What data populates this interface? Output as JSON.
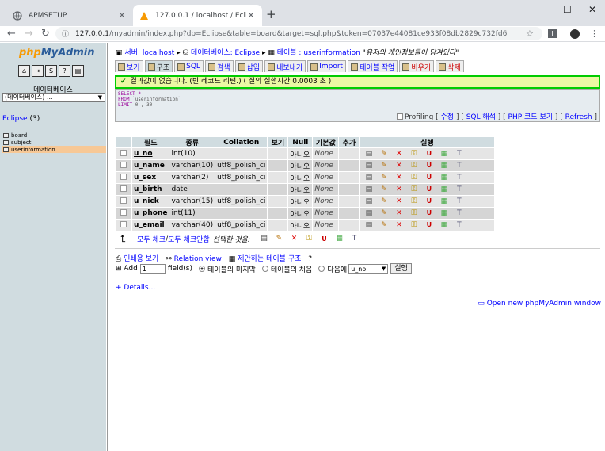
{
  "browser": {
    "tabs": [
      {
        "title": "APMSETUP",
        "active": false
      },
      {
        "title": "127.0.0.1 / localhost / Eclipse / ",
        "active": true
      }
    ],
    "url_host": "127.0.0.1",
    "url_path": "/myadmin/index.php?db=Eclipse&table=board&target=sql.php&token=07037e44081ce933f08db2829c732fd6"
  },
  "left": {
    "logo_a": "php",
    "logo_b": "MyAdmin",
    "db_label": "데이터베이스",
    "db_select": "(데이터베이스) ...",
    "db_name": "Eclipse",
    "db_count": "(3)",
    "tables": [
      "board",
      "subject",
      "userinformation"
    ]
  },
  "breadcrumb": {
    "server": "서버: localhost",
    "database": "데이터베이스: Eclipse",
    "table": "테이블 : userinformation",
    "comment": "\"유저의 개인정보들이 담겨있다\""
  },
  "tabs": [
    "보기",
    "구조",
    "SQL",
    "검색",
    "삽입",
    "내보내기",
    "Import",
    "테이블 작업",
    "비우기",
    "삭제"
  ],
  "notice": "결과값이 없습니다. (빈 레코드 리턴.) ( 질의 실행시간 0.0003 초 )",
  "sql": {
    "select": "SELECT",
    "star": "*",
    "from": "FROM",
    "table": "`userinformation`",
    "limit": "LIMIT",
    "limit_val": "0 , 30"
  },
  "profiling": {
    "label": "Profiling",
    "edit": "수정",
    "explain": "SQL 해석",
    "php": "PHP 코드 보기",
    "refresh": "Refresh"
  },
  "table_headers": [
    "필드",
    "종류",
    "Collation",
    "보기",
    "Null",
    "기본값",
    "추가",
    "실행"
  ],
  "rows": [
    {
      "field": "u_no",
      "type": "int(10)",
      "collation": "",
      "null": "아니오",
      "default": "None",
      "pk": true
    },
    {
      "field": "u_name",
      "type": "varchar(10)",
      "collation": "utf8_polish_ci",
      "null": "아니오",
      "default": "None",
      "pk": false
    },
    {
      "field": "u_sex",
      "type": "varchar(2)",
      "collation": "utf8_polish_ci",
      "null": "아니오",
      "default": "None",
      "pk": false
    },
    {
      "field": "u_birth",
      "type": "date",
      "collation": "",
      "null": "아니오",
      "default": "None",
      "pk": false
    },
    {
      "field": "u_nick",
      "type": "varchar(15)",
      "collation": "utf8_polish_ci",
      "null": "아니오",
      "default": "None",
      "pk": false
    },
    {
      "field": "u_phone",
      "type": "int(11)",
      "collation": "",
      "null": "아니오",
      "default": "None",
      "pk": false
    },
    {
      "field": "u_email",
      "type": "varchar(40)",
      "collation": "utf8_polish_ci",
      "null": "아니오",
      "default": "None",
      "pk": false
    }
  ],
  "selection": {
    "check_all": "모두 체크",
    "sep": " / ",
    "uncheck_all": "모두 체크안함",
    "with_selected": "선택한 것을:"
  },
  "links": {
    "print": "인쇄용 보기",
    "relation": "Relation view",
    "propose": "제안하는 테이블 구조"
  },
  "add": {
    "label": "Add",
    "count": "1",
    "fields": "field(s)",
    "end": "테이블의 마지막",
    "begin": "테이블의 처음",
    "after": "다음에",
    "after_field": "u_no",
    "go": "실행"
  },
  "details": "+ Details...",
  "open_window": "Open new phpMyAdmin window"
}
